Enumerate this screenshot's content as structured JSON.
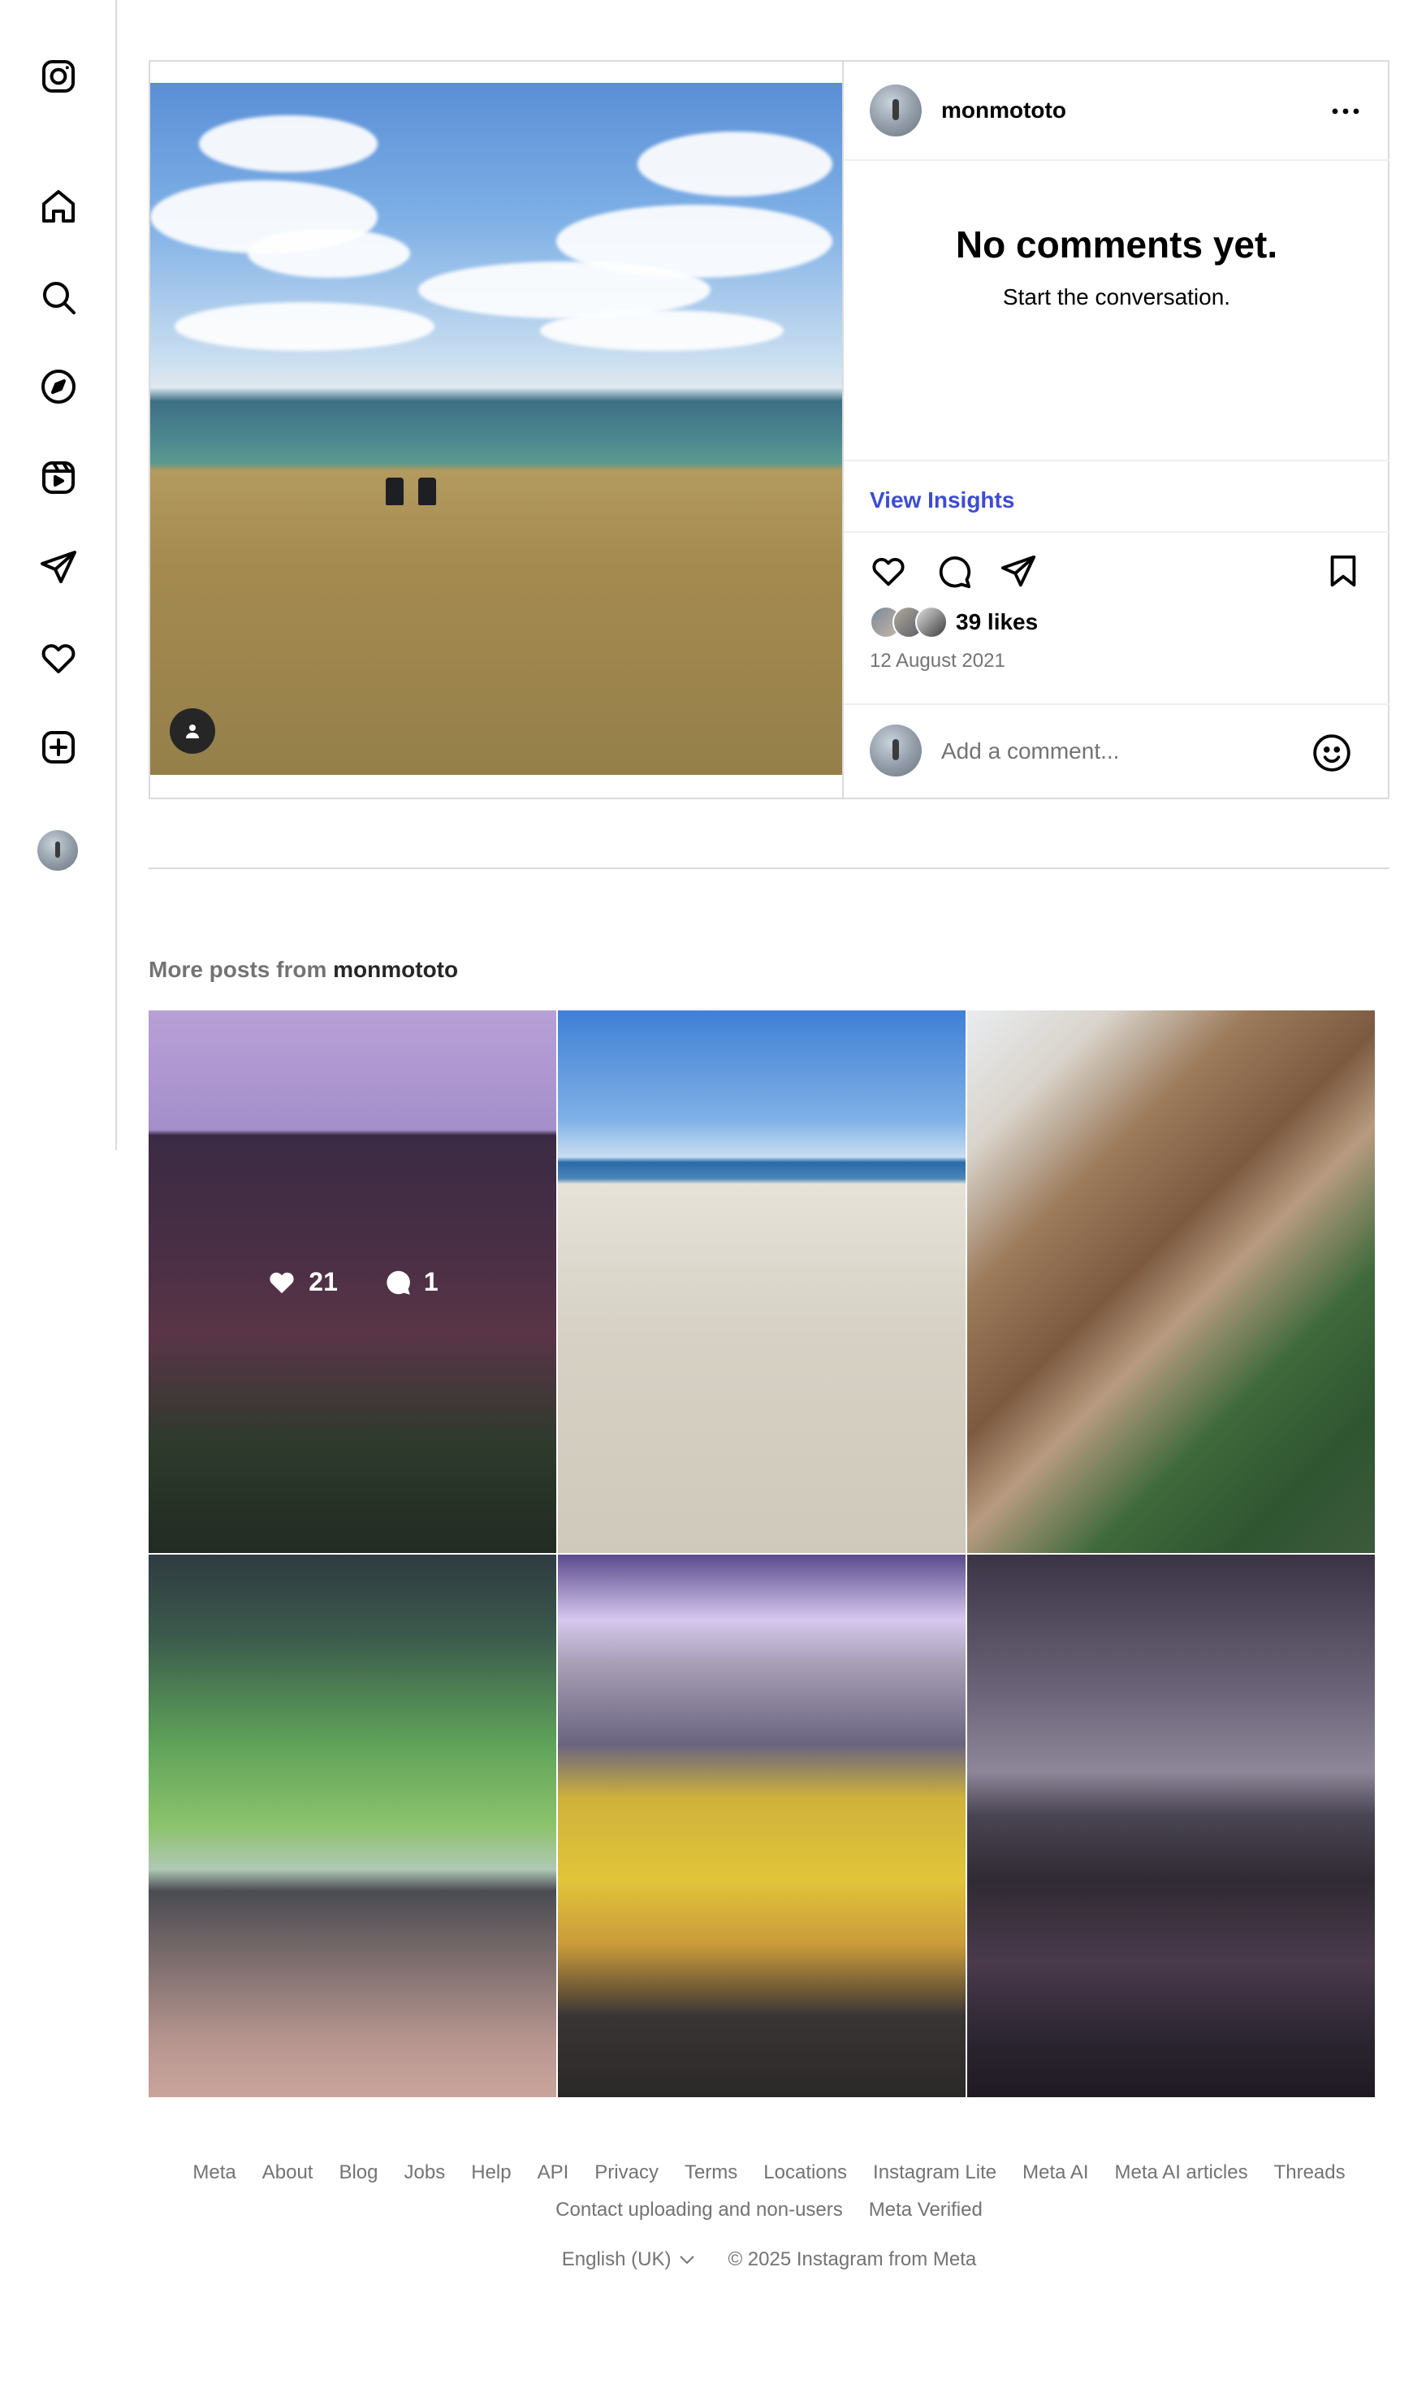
{
  "post": {
    "username": "monmototo",
    "no_comments_title": "No comments yet.",
    "no_comments_sub": "Start the conversation.",
    "view_insights": "View Insights",
    "likes": "39 likes",
    "date": "12 August 2021",
    "comment_placeholder": "Add a comment..."
  },
  "more_posts": {
    "prefix": "More posts from",
    "username": "monmototo",
    "tiles": [
      {
        "likes": "21",
        "comments": "1"
      }
    ]
  },
  "footer": {
    "links": [
      "Meta",
      "About",
      "Blog",
      "Jobs",
      "Help",
      "API",
      "Privacy",
      "Terms",
      "Locations",
      "Instagram Lite",
      "Meta AI",
      "Meta AI articles",
      "Threads"
    ],
    "links2": [
      "Contact uploading and non-users",
      "Meta Verified"
    ],
    "language": "English (UK)",
    "copyright": "© 2025 Instagram from Meta"
  },
  "colors": {
    "link_blue": "#3d4bd4",
    "muted": "#737373",
    "border": "#dbdbdb"
  },
  "icons": [
    "instagram-icon",
    "home-icon",
    "search-icon",
    "explore-icon",
    "reels-icon",
    "messages-icon",
    "notifications-icon",
    "create-icon",
    "profile-avatar",
    "more-options-icon",
    "like-icon",
    "comment-icon",
    "share-icon",
    "save-icon",
    "emoji-icon",
    "tagged-user-icon",
    "chevron-down-icon"
  ]
}
